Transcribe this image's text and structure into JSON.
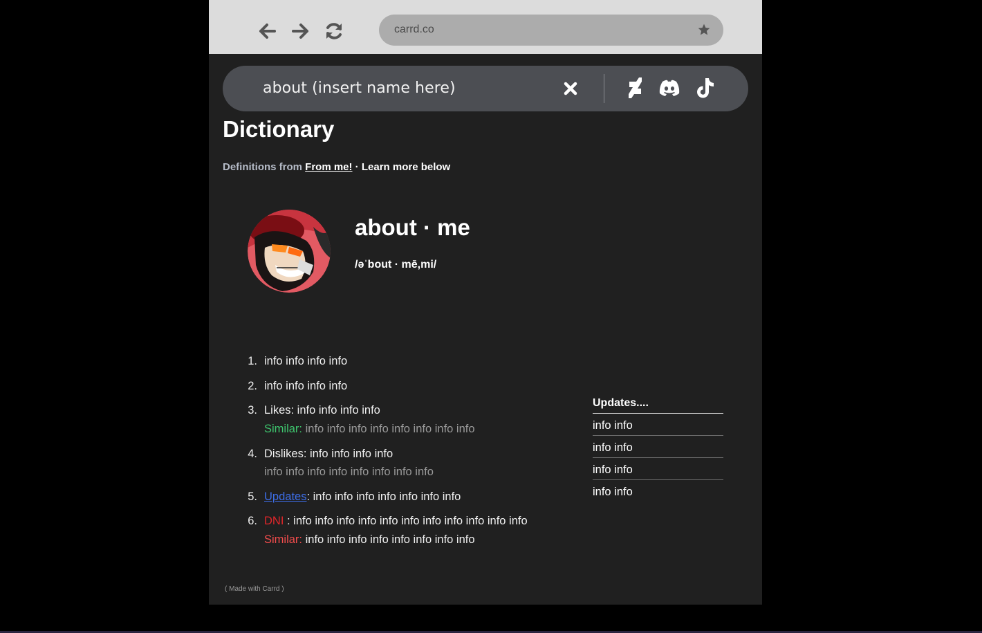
{
  "browser": {
    "url": "carrd.co"
  },
  "search": {
    "query": "about (insert name here)"
  },
  "header": {
    "title": "Dictionary",
    "definitions_prefix": "Definitions from",
    "source_link": "From me!",
    "suffix": " · Learn more below"
  },
  "entry": {
    "word": "about · me",
    "phonetic": "/əˈbout · mē,mi/"
  },
  "definitions": [
    {
      "number": "1.",
      "text": "info info info info"
    },
    {
      "number": "2.",
      "text": "info info info info"
    },
    {
      "number": "3.",
      "text": "Likes: info info info info",
      "sub_label": "Similar:",
      "sub_text": " info info info info info info info info"
    },
    {
      "number": "4.",
      "text": "Dislikes: info info info info",
      "sub_text": "info info info info info info info info"
    },
    {
      "number": "5.",
      "link": "Updates",
      "text": ": info info info info info info info"
    },
    {
      "number": "6.",
      "label": "DNI",
      "text": " : info info info info info info info info info info info",
      "sub_label": "Similar:",
      "sub_text": " info info info info info info info info"
    }
  ],
  "updates": {
    "title": "Updates....",
    "items": [
      "info info",
      "info info",
      "info info",
      "info info"
    ]
  },
  "footer": {
    "made_with": "( Made with Carrd )"
  },
  "colors": {
    "page_bg": "#202020",
    "pill_bg": "#4c4e53",
    "similar_green": "#3ec46d",
    "updates_link_blue": "#3d6ee8",
    "dni_red": "#e0262a",
    "similar_red": "#f24c4c"
  },
  "icons": [
    "back-arrow-icon",
    "forward-arrow-icon",
    "reload-icon",
    "star-icon",
    "close-icon",
    "deviantart-icon",
    "discord-icon",
    "tiktok-icon"
  ]
}
